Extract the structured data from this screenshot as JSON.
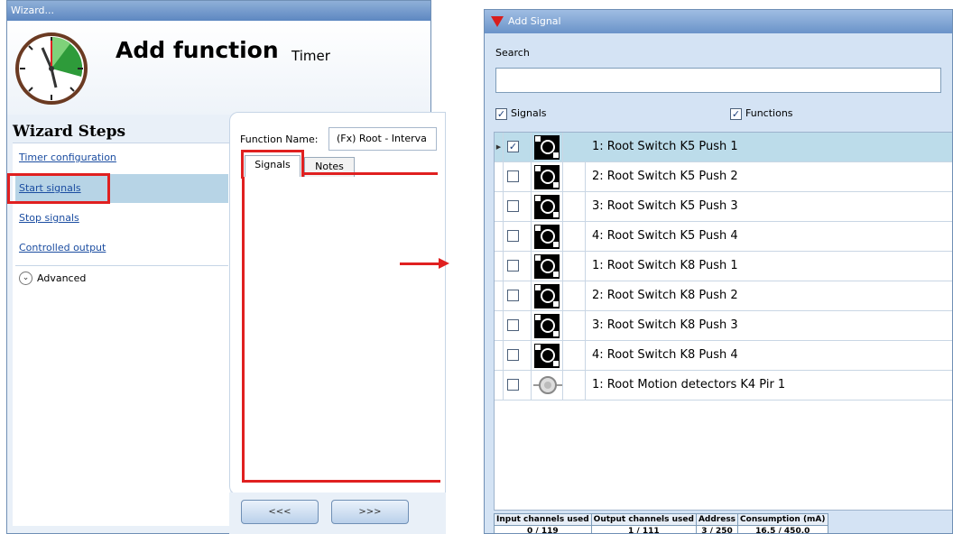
{
  "wizard": {
    "window_title": "Wizard...",
    "heading": "Add function",
    "subheading": "Timer",
    "steps_title": "Wizard Steps",
    "steps": [
      {
        "label": "Timer configuration"
      },
      {
        "label": "Start signals"
      },
      {
        "label": "Stop signals"
      },
      {
        "label": "Controlled output"
      }
    ],
    "advanced_label": "Advanced",
    "function_name_label": "Function Name:",
    "function_name_value": "(Fx) Root - Interva",
    "tabs": [
      {
        "label": "Signals"
      },
      {
        "label": "Notes"
      }
    ],
    "prev_button": "<<<",
    "next_button": ">>>"
  },
  "add_signal": {
    "window_title": "Add Signal",
    "search_label": "Search",
    "search_value": "",
    "filter_signals": "Signals",
    "filter_functions": "Functions",
    "rows": [
      {
        "label": "1: Root Switch K5 Push 1",
        "checked": "✓",
        "icon": "switch-icon"
      },
      {
        "label": "2: Root Switch K5 Push 2",
        "checked": "",
        "icon": "switch-icon"
      },
      {
        "label": "3: Root Switch K5 Push 3",
        "checked": "",
        "icon": "switch-icon"
      },
      {
        "label": "4: Root Switch K5 Push 4",
        "checked": "",
        "icon": "switch-icon"
      },
      {
        "label": "1: Root Switch K8 Push 1",
        "checked": "",
        "icon": "switch-icon"
      },
      {
        "label": "2: Root Switch K8 Push 2",
        "checked": "",
        "icon": "switch-icon"
      },
      {
        "label": "3: Root Switch K8 Push 3",
        "checked": "",
        "icon": "switch-icon"
      },
      {
        "label": "4: Root Switch K8 Push 4",
        "checked": "",
        "icon": "switch-icon"
      },
      {
        "label": "1: Root Motion detectors K4 Pir 1",
        "checked": "",
        "icon": "motion-detector-icon"
      }
    ],
    "stats": {
      "headers": [
        "Input channels used",
        "Output channels used",
        "Address",
        "Consumption (mA)"
      ],
      "values": [
        "0 / 119",
        "1 / 111",
        "3 / 250",
        "16,5 / 450,0"
      ]
    }
  }
}
